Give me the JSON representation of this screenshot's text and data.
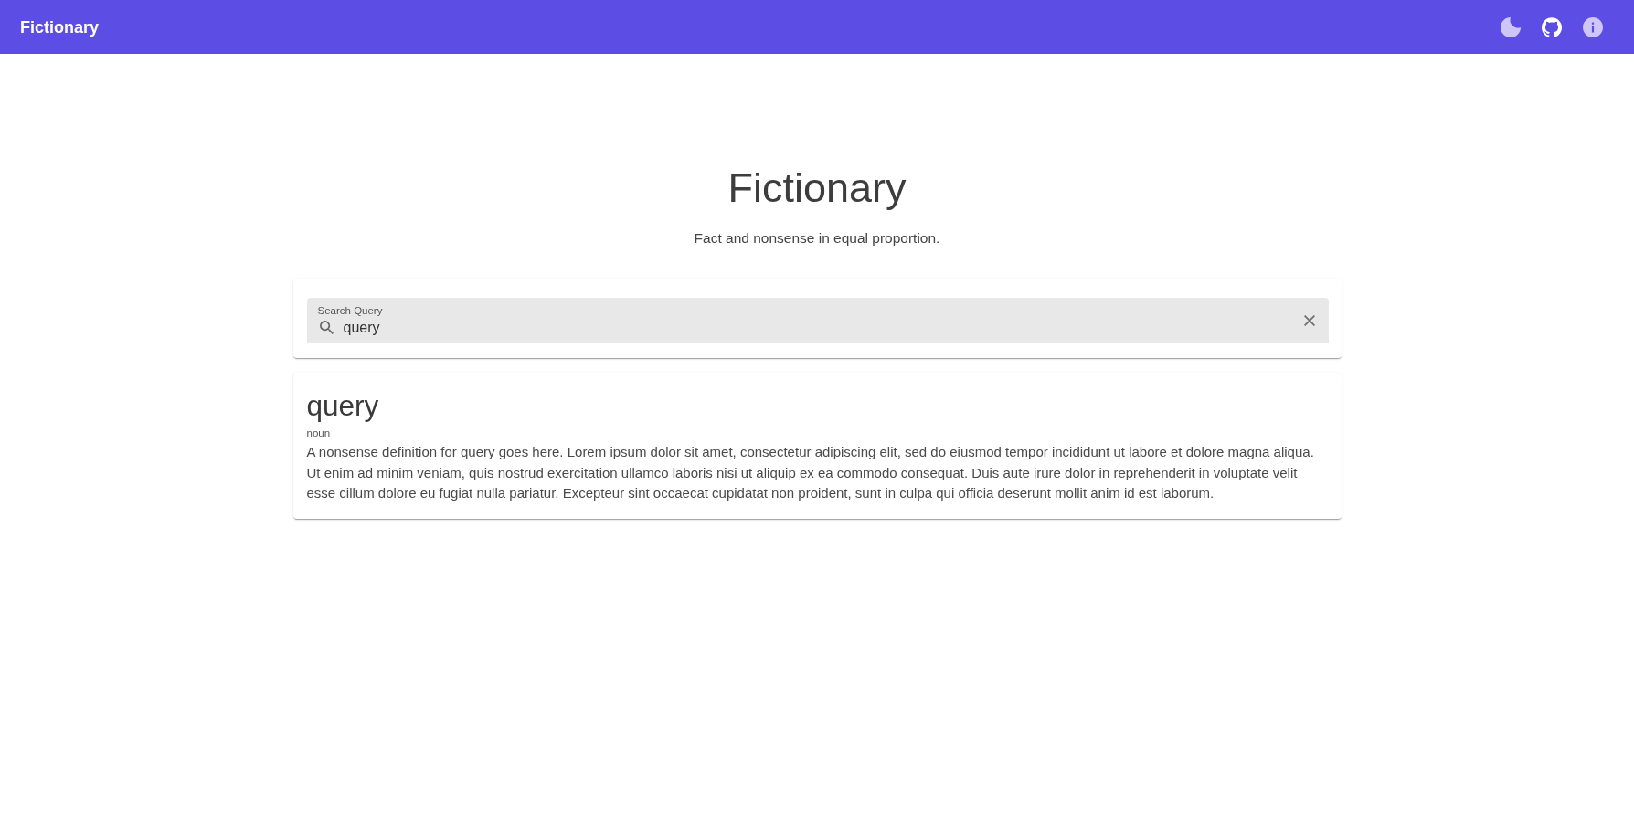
{
  "app_bar": {
    "title": "Fictionary"
  },
  "hero": {
    "title": "Fictionary",
    "tagline": "Fact and nonsense in equal proportion."
  },
  "search": {
    "label": "Search Query",
    "value": "query"
  },
  "results": [
    {
      "word": "query",
      "part_of_speech": "noun",
      "definition": "A nonsense definition for query goes here. Lorem ipsum dolor sit amet, consectetur adipiscing elit, sed do eiusmod tempor incididunt ut labore et dolore magna aliqua. Ut enim ad minim veniam, quis nostrud exercitation ullamco laboris nisi ut aliquip ex ea commodo consequat. Duis aute irure dolor in reprehenderit in voluptate velit esse cillum dolore eu fugiat nulla pariatur. Excepteur sint occaecat cupidatat non proident, sunt in culpa qui officia deserunt mollit anim id est laborum."
    }
  ]
}
